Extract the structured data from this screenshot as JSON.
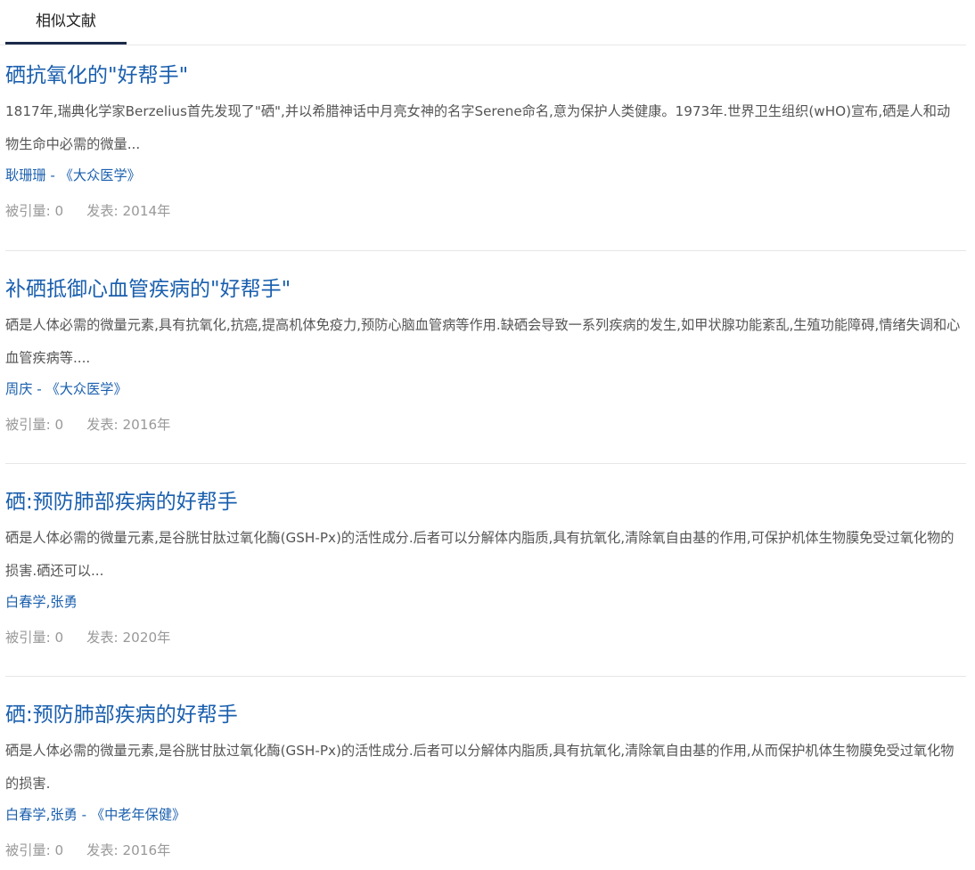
{
  "tabs": [
    {
      "label": "相似文献"
    }
  ],
  "articles": [
    {
      "title": "硒抗氧化的\"好帮手\"",
      "abstract": "1817年,瑞典化学家Berzelius首先发现了\"硒\",并以希腊神话中月亮女神的名字Serene命名,意为保护人类健康。1973年.世界卫生组织(wHO)宣布,硒是人和动物生命中必需的微量...",
      "authors_source": "耿珊珊 - 《大众医学》",
      "citations": "被引量: 0",
      "published": "发表: 2014年"
    },
    {
      "title": "补硒抵御心血管疾病的\"好帮手\"",
      "abstract": "硒是人体必需的微量元素,具有抗氧化,抗癌,提高机体免疫力,预防心脑血管病等作用.缺硒会导致一系列疾病的发生,如甲状腺功能紊乱,生殖功能障碍,情绪失调和心血管疾病等....",
      "authors_source": "周庆 - 《大众医学》",
      "citations": "被引量: 0",
      "published": "发表: 2016年"
    },
    {
      "title": "硒:预防肺部疾病的好帮手",
      "abstract": "硒是人体必需的微量元素,是谷胱甘肽过氧化酶(GSH-Px)的活性成分.后者可以分解体内脂质,具有抗氧化,清除氧自由基的作用,可保护机体生物膜免受过氧化物的损害.硒还可以...",
      "authors_source": "白春学,张勇",
      "citations": "被引量: 0",
      "published": "发表: 2020年"
    },
    {
      "title": "硒:预防肺部疾病的好帮手",
      "abstract": "硒是人体必需的微量元素,是谷胱甘肽过氧化酶(GSH-Px)的活性成分.后者可以分解体内脂质,具有抗氧化,清除氧自由基的作用,从而保护机体生物膜免受过氧化物的损害.",
      "authors_source": "白春学,张勇 - 《中老年保健》",
      "citations": "被引量: 0",
      "published": "发表: 2016年"
    }
  ]
}
